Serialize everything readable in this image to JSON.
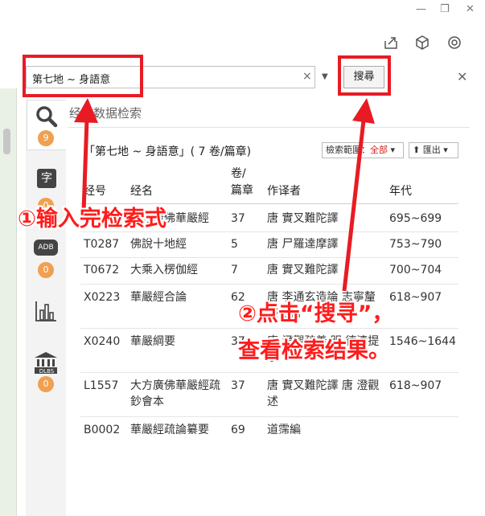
{
  "window": {
    "minimize": "—",
    "restore": "❐",
    "close": "✕"
  },
  "search": {
    "value": "第七地 ~ 身語意",
    "clear": "×",
    "dropdown": "▼",
    "button": "搜尋",
    "panel_close": "✕"
  },
  "tabs": [
    {
      "icon": "search-icon",
      "badge": "9"
    },
    {
      "icon": "dictionary-icon",
      "glyph": "字",
      "badge": "0"
    },
    {
      "icon": "adb-icon",
      "glyph": "ADB",
      "badge": "0"
    },
    {
      "icon": "chart-icon",
      "badge": ""
    },
    {
      "icon": "dlbs-icon",
      "glyph": "DLBS",
      "badge": "0"
    }
  ],
  "content": {
    "page_heading": "经文数据检索",
    "query_title": "「第七地 ~ 身語意」( 7 卷/篇章)",
    "scope_label": "檢索範圍：",
    "scope_value": "全部",
    "export_label": "匯出",
    "columns": {
      "id": "经号",
      "name": "经名",
      "juan": "卷/\n篇章",
      "translator": "作译者",
      "era": "年代"
    },
    "rows": [
      {
        "id": "T0279",
        "name": "大方廣佛華嚴經",
        "juan": "37",
        "translator": "唐 實叉難陀譯",
        "era": "695~699"
      },
      {
        "id": "T0287",
        "name": "佛說十地經",
        "juan": "5",
        "translator": "唐 尸羅達摩譯",
        "era": "753~790"
      },
      {
        "id": "T0672",
        "name": "大乘入楞伽經",
        "juan": "7",
        "translator": "唐 實叉難陀譯",
        "era": "700~704"
      },
      {
        "id": "X0223",
        "name": "華嚴經合論",
        "juan": "62",
        "translator": "唐 李通玄造論 志寧釐經合論",
        "era": "618~907"
      },
      {
        "id": "X0240",
        "name": "華嚴綱要",
        "juan": "37",
        "translator": "唐 澄觀疏義 明 德清提挈",
        "era": "1546~1644"
      },
      {
        "id": "L1557",
        "name": "大方廣佛華嚴經疏鈔會本",
        "juan": "37",
        "translator": "唐 實叉難陀譯 唐 澄觀述",
        "era": "618~907"
      },
      {
        "id": "B0002",
        "name": "華嚴經疏論纂要",
        "juan": "69",
        "translator": "道霈編",
        "era": ""
      }
    ]
  },
  "annotations": {
    "step1": "①输入完检索式",
    "step2_line1": "②点击“搜寻”，",
    "step2_line2": "查看检索结果。"
  },
  "colors": {
    "annotation_red": "#e81b24",
    "badge_orange": "#f0a050",
    "accent_red": "#d02020"
  }
}
